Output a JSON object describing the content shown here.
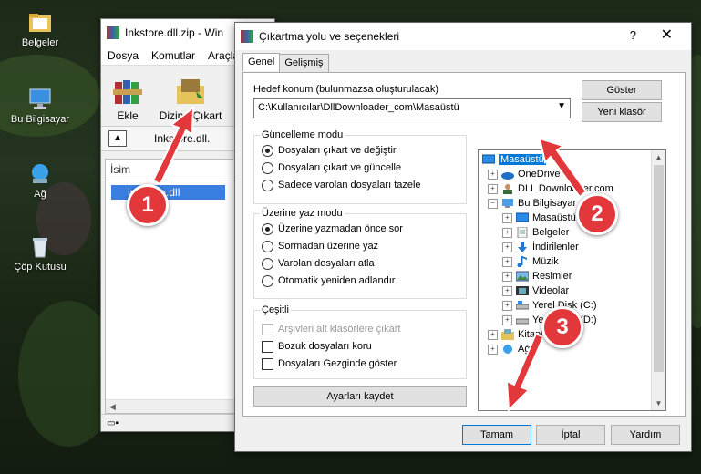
{
  "desktop": {
    "icons": [
      {
        "label": "Belgeler",
        "icon": "folder-icon"
      },
      {
        "label": "Bu Bilgisayar",
        "icon": "computer-icon"
      },
      {
        "label": "Ağ",
        "icon": "network-icon"
      },
      {
        "label": "Çöp Kutusu",
        "icon": "recycle-bin-icon"
      }
    ]
  },
  "winrar": {
    "title": "Inkstore.dll.zip - Win",
    "menu": [
      "Dosya",
      "Komutlar",
      "Araçla"
    ],
    "toolbar": {
      "extract_label": "Ekle",
      "extract_to_label": "Dizine Çıkart"
    },
    "path": "Inkstore.dll.",
    "column_name": "İsim",
    "file": "inkstore.dll"
  },
  "dialog": {
    "title": "Çıkartma yolu ve seçenekleri",
    "help": "?",
    "close": "✕",
    "tabs": [
      "Genel",
      "Gelişmiş"
    ],
    "dest_label": "Hedef konum (bulunmazsa oluşturulacak)",
    "dest_value": "C:\\Kullanıcılar\\DllDownloader_com\\Masaüstü",
    "show_button": "Göster",
    "new_folder_button": "Yeni klasör",
    "update_mode": {
      "title": "Güncelleme modu",
      "options": [
        "Dosyaları çıkart ve değiştir",
        "Dosyaları çıkart ve güncelle",
        "Sadece varolan dosyaları tazele"
      ]
    },
    "overwrite_mode": {
      "title": "Üzerine yaz modu",
      "options": [
        "Üzerine yazmadan önce sor",
        "Sormadan üzerine yaz",
        "Varolan dosyaları atla",
        "Otomatik yeniden adlandır"
      ]
    },
    "misc": {
      "title": "Çeşitli",
      "options": [
        "Arşivleri alt klasörlere çıkart",
        "Bozuk dosyaları koru",
        "Dosyaları Gezginde göster"
      ]
    },
    "save_button": "Ayarları kaydet",
    "tree": [
      {
        "label": "Masaüstü",
        "icon": "desktop-icon"
      },
      {
        "label": "OneDrive",
        "icon": "cloud-icon"
      },
      {
        "label": "DLL Downloader.com",
        "icon": "user-icon"
      },
      {
        "label": "Bu Bilgisayar",
        "icon": "computer-icon"
      },
      {
        "label": "Masaüstü",
        "icon": "desktop-icon"
      },
      {
        "label": "Belgeler",
        "icon": "documents-icon"
      },
      {
        "label": "İndirilenler",
        "icon": "download-icon"
      },
      {
        "label": "Müzik",
        "icon": "music-icon"
      },
      {
        "label": "Resimler",
        "icon": "pictures-icon"
      },
      {
        "label": "Videolar",
        "icon": "video-icon"
      },
      {
        "label": "Yerel Disk (C:)",
        "icon": "drive-icon"
      },
      {
        "label": "Yerel Disk (D:)",
        "icon": "drive-icon"
      },
      {
        "label": "Kitapl",
        "icon": "library-icon"
      },
      {
        "label": "Ağ",
        "icon": "network-icon"
      }
    ],
    "ok_button": "Tamam",
    "cancel_button": "İptal",
    "help_button": "Yardım"
  },
  "callouts": [
    "1",
    "2",
    "3"
  ],
  "colors": {
    "selection": "#0078d7",
    "callout": "#e2383b",
    "arrow": "#e2383b"
  }
}
